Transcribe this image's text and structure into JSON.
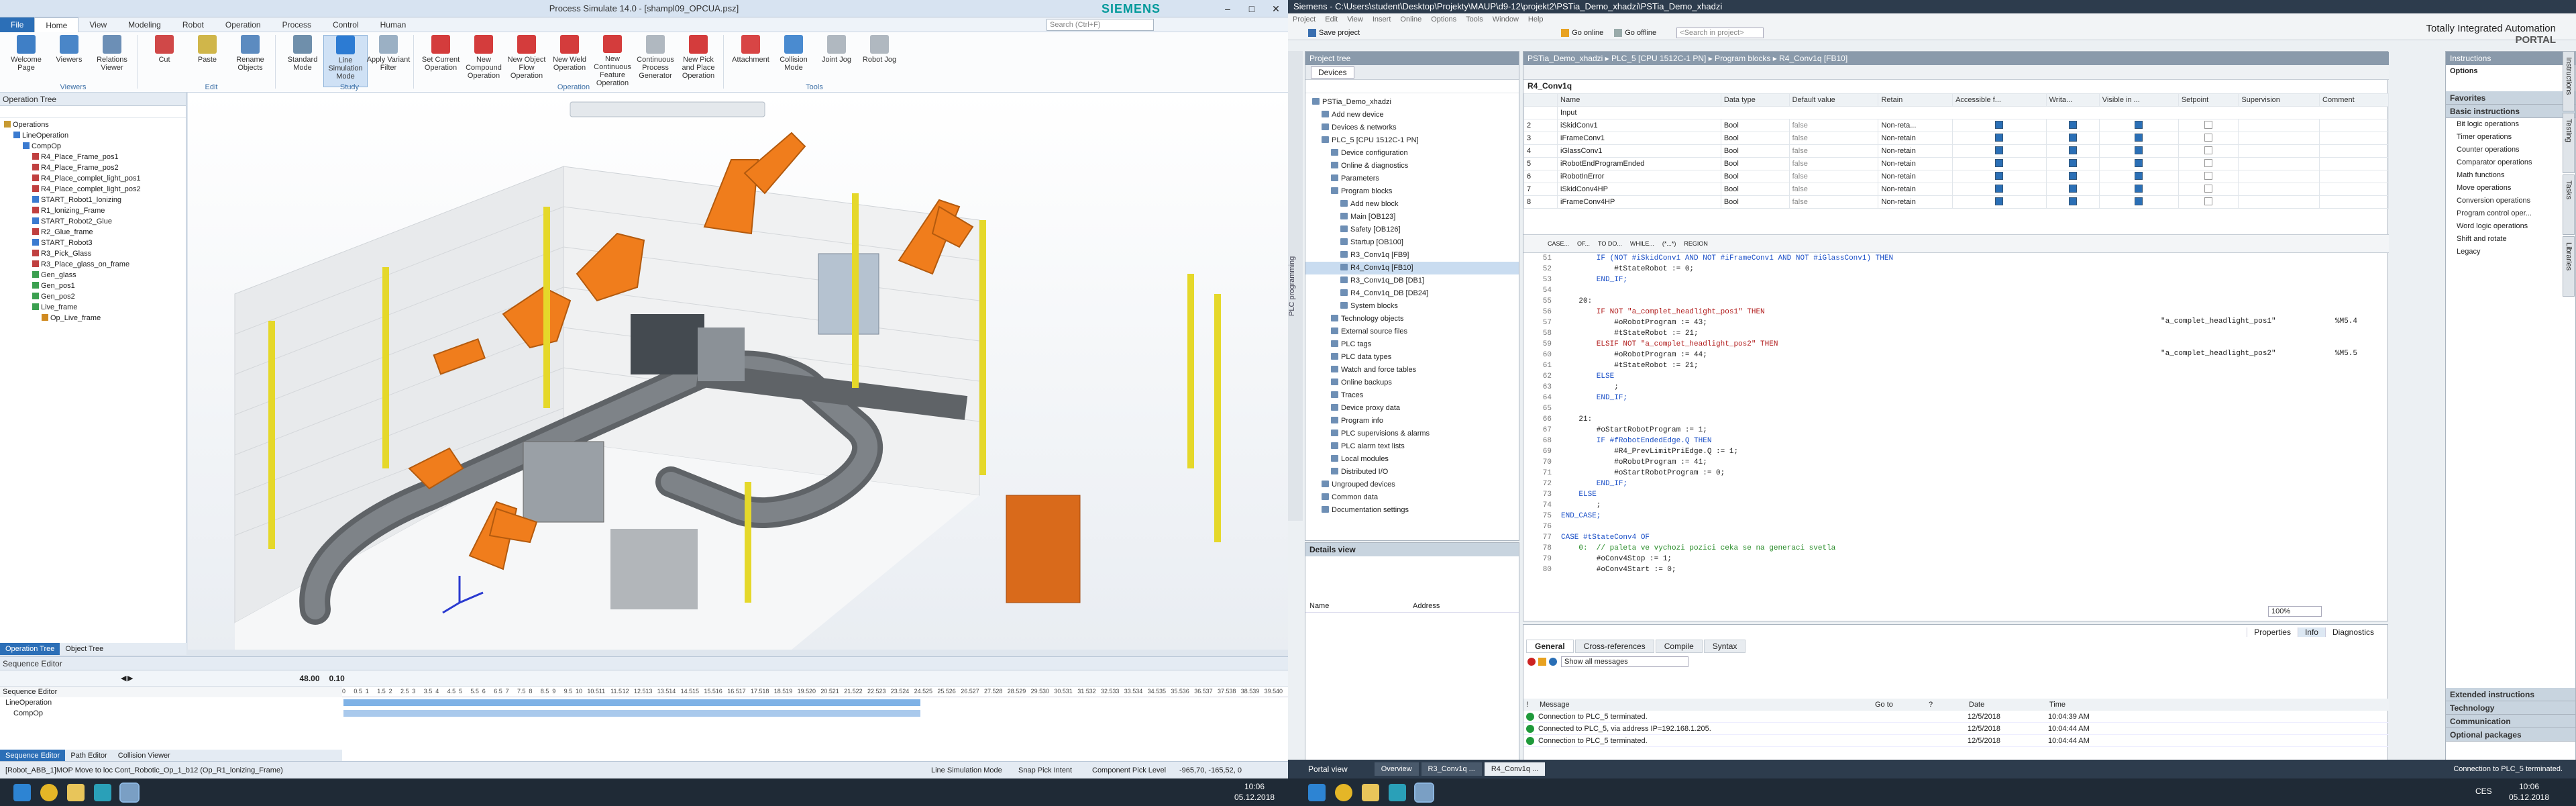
{
  "ps": {
    "title": "Process Simulate 14.0 - [shampl09_OPCUA.psz]",
    "brand": "SIEMENS",
    "menu": [
      "File",
      "Home",
      "View",
      "Modeling",
      "Robot",
      "Operation",
      "Process",
      "Control",
      "Human"
    ],
    "search_placeholder": "Search (Ctrl+F)",
    "ribbon": [
      {
        "label": "Welcome Page",
        "group": "Viewers"
      },
      {
        "label": "Viewers",
        "group": "Viewers"
      },
      {
        "label": "Relations Viewer",
        "group": "Viewers"
      },
      {
        "label": "Cut",
        "group": "Edit"
      },
      {
        "label": "Paste",
        "group": "Edit"
      },
      {
        "label": "Rename Objects",
        "group": "Edit"
      },
      {
        "label": "Standard Mode",
        "group": "Study"
      },
      {
        "label": "Line Simulation Mode",
        "group": "Study"
      },
      {
        "label": "Apply Variant Filter",
        "group": "Study"
      },
      {
        "label": "Set Current Operation",
        "group": "Operation"
      },
      {
        "label": "New Compound Operation",
        "group": "Operation"
      },
      {
        "label": "New Object Flow Operation",
        "group": "Operation"
      },
      {
        "label": "New Weld Operation",
        "group": "Operation"
      },
      {
        "label": "New Continuous Feature Operation",
        "group": "Operation"
      },
      {
        "label": "Continuous Process Generator",
        "group": "Operation"
      },
      {
        "label": "New Pick and Place Operation",
        "group": "Operation"
      },
      {
        "label": "Attachment",
        "group": "Tools"
      },
      {
        "label": "Collision Mode",
        "group": "Tools"
      },
      {
        "label": "Joint Jog",
        "group": "Tools"
      },
      {
        "label": "Robot Jog",
        "group": "Tools"
      }
    ],
    "ribbon_groups": [
      "Viewers",
      "Edit",
      "Study",
      "Operation",
      "Tools"
    ],
    "optree_title": "Operation Tree",
    "optree": [
      {
        "label": "Operations",
        "lvl": 0,
        "c": "#c79a32"
      },
      {
        "label": "LineOperation",
        "lvl": 1,
        "c": "#3b7bd0"
      },
      {
        "label": "CompOp",
        "lvl": 2,
        "c": "#3b7bd0"
      },
      {
        "label": "R4_Place_Frame_pos1",
        "lvl": 3,
        "c": "#c04040"
      },
      {
        "label": "R4_Place_Frame_pos2",
        "lvl": 3,
        "c": "#c04040"
      },
      {
        "label": "R4_Place_complet_light_pos1",
        "lvl": 3,
        "c": "#c04040"
      },
      {
        "label": "R4_Place_complet_light_pos2",
        "lvl": 3,
        "c": "#c04040"
      },
      {
        "label": "START_Robot1_lonizing",
        "lvl": 3,
        "c": "#3b7bd0"
      },
      {
        "label": "R1_lonizing_Frame",
        "lvl": 3,
        "c": "#c04040"
      },
      {
        "label": "START_Robot2_Glue",
        "lvl": 3,
        "c": "#3b7bd0"
      },
      {
        "label": "R2_Glue_frame",
        "lvl": 3,
        "c": "#c04040"
      },
      {
        "label": "START_Robot3",
        "lvl": 3,
        "c": "#3b7bd0"
      },
      {
        "label": "R3_Pick_Glass",
        "lvl": 3,
        "c": "#c04040"
      },
      {
        "label": "R3_Place_glass_on_frame",
        "lvl": 3,
        "c": "#c04040"
      },
      {
        "label": "Gen_glass",
        "lvl": 3,
        "c": "#3ba050"
      },
      {
        "label": "Gen_pos1",
        "lvl": 3,
        "c": "#3ba050"
      },
      {
        "label": "Gen_pos2",
        "lvl": 3,
        "c": "#3ba050"
      },
      {
        "label": "Live_frame",
        "lvl": 3,
        "c": "#3ba050"
      },
      {
        "label": "Op_Live_frame",
        "lvl": 4,
        "c": "#d08a20"
      }
    ],
    "tree_tabs": [
      "Operation Tree",
      "Object Tree"
    ],
    "seq_title": "Sequence Editor",
    "seq_time": "48.00",
    "seq_step": "0.10",
    "seq_rows": [
      "LineOperation",
      "CompOp"
    ],
    "seq_tabs": [
      "Sequence Editor",
      "Path Editor",
      "Collision Viewer"
    ],
    "ruler": [
      "0",
      "0.5",
      "1",
      "1.5",
      "2",
      "2.5",
      "3",
      "3.5",
      "4",
      "4.5",
      "5",
      "5.5",
      "6",
      "6.5",
      "7",
      "7.5",
      "8",
      "8.5",
      "9",
      "9.5",
      "10",
      "10.5",
      "11",
      "11.5",
      "12",
      "12.5",
      "13",
      "13.5",
      "14",
      "14.5",
      "15",
      "15.5",
      "16",
      "16.5",
      "17",
      "17.5",
      "18",
      "18.5",
      "19",
      "19.5",
      "20",
      "20.5",
      "21",
      "21.5",
      "22",
      "22.5",
      "23",
      "23.5",
      "24",
      "24.5",
      "25",
      "25.5",
      "26",
      "26.5",
      "27",
      "27.5",
      "28",
      "28.5",
      "29",
      "29.5",
      "30",
      "30.5",
      "31",
      "31.5",
      "32",
      "32.5",
      "33",
      "33.5",
      "34",
      "34.5",
      "35",
      "35.5",
      "36",
      "36.5",
      "37",
      "37.5",
      "38",
      "38.5",
      "39",
      "39.5",
      "40"
    ],
    "status_left": "[Robot_ABB_1]MOP Move to loc Cont_Robotic_Op_1_b12 (Op_R1_lonizing_Frame)",
    "status_mode": "Line Simulation Mode",
    "status_pick": "Snap Pick Intent",
    "status_level": "Component Pick Level",
    "status_coords": "-965,70, -165,52, 0"
  },
  "tia": {
    "title": "Siemens  -  C:\\Users\\student\\Desktop\\Projekty\\MAUP\\d9-12\\projekt2\\PSTia_Demo_xhadzi\\PSTia_Demo_xhadzi",
    "menu": [
      "Project",
      "Edit",
      "View",
      "Insert",
      "Online",
      "Options",
      "Tools",
      "Window",
      "Help"
    ],
    "toolbar": {
      "save": "Save project",
      "online": "Go online",
      "offline": "Go offline",
      "search": "<Search in project>"
    },
    "brand1": "Totally Integrated Automation",
    "brand2": "PORTAL",
    "project_tree_title": "Project tree",
    "devices_tab": "Devices",
    "tree": [
      {
        "label": "PSTia_Demo_xhadzi",
        "lvl": 0
      },
      {
        "label": "Add new device",
        "lvl": 1
      },
      {
        "label": "Devices & networks",
        "lvl": 1
      },
      {
        "label": "PLC_5 [CPU 1512C-1 PN]",
        "lvl": 1
      },
      {
        "label": "Device configuration",
        "lvl": 2
      },
      {
        "label": "Online & diagnostics",
        "lvl": 2
      },
      {
        "label": "Parameters",
        "lvl": 2
      },
      {
        "label": "Program blocks",
        "lvl": 2
      },
      {
        "label": "Add new block",
        "lvl": 3
      },
      {
        "label": "Main [OB123]",
        "lvl": 3
      },
      {
        "label": "Safety [OB126]",
        "lvl": 3
      },
      {
        "label": "Startup [OB100]",
        "lvl": 3
      },
      {
        "label": "R3_Conv1q [FB9]",
        "lvl": 3
      },
      {
        "label": "R4_Conv1q [FB10]",
        "lvl": 3,
        "sel": true
      },
      {
        "label": "R3_Conv1q_DB [DB1]",
        "lvl": 3
      },
      {
        "label": "R4_Conv1q_DB [DB24]",
        "lvl": 3
      },
      {
        "label": "System blocks",
        "lvl": 3
      },
      {
        "label": "Technology objects",
        "lvl": 2
      },
      {
        "label": "External source files",
        "lvl": 2
      },
      {
        "label": "PLC tags",
        "lvl": 2
      },
      {
        "label": "PLC data types",
        "lvl": 2
      },
      {
        "label": "Watch and force tables",
        "lvl": 2
      },
      {
        "label": "Online backups",
        "lvl": 2
      },
      {
        "label": "Traces",
        "lvl": 2
      },
      {
        "label": "Device proxy data",
        "lvl": 2
      },
      {
        "label": "Program info",
        "lvl": 2
      },
      {
        "label": "PLC supervisions & alarms",
        "lvl": 2
      },
      {
        "label": "PLC alarm text lists",
        "lvl": 2
      },
      {
        "label": "Local modules",
        "lvl": 2
      },
      {
        "label": "Distributed I/O",
        "lvl": 2
      },
      {
        "label": "Ungrouped devices",
        "lvl": 1
      },
      {
        "label": "Common data",
        "lvl": 1
      },
      {
        "label": "Documentation settings",
        "lvl": 1
      }
    ],
    "details_title": "Details view",
    "details_cols": [
      "Name",
      "Address"
    ],
    "breadcrumb": "PSTia_Demo_xhadzi  ▸  PLC_5 [CPU 1512C-1 PN]  ▸  Program blocks  ▸  R4_Conv1q [FB10]",
    "block_name": "R4_Conv1q",
    "iface_cols": [
      "Name",
      "Data type",
      "Default value",
      "Retain",
      "Accessible f...",
      "Writa...",
      "Visible in ...",
      "Setpoint",
      "Supervision",
      "Comment"
    ],
    "iface_section": "Input",
    "iface_rows": [
      {
        "no": "2",
        "name": "iSkidConv1",
        "type": "Bool",
        "def": "false",
        "ret": "Non-reta..."
      },
      {
        "no": "3",
        "name": "iFrameConv1",
        "type": "Bool",
        "def": "false",
        "ret": "Non-retain"
      },
      {
        "no": "4",
        "name": "iGlassConv1",
        "type": "Bool",
        "def": "false",
        "ret": "Non-retain"
      },
      {
        "no": "5",
        "name": "iRobotEndProgramEnded",
        "type": "Bool",
        "def": "false",
        "ret": "Non-retain"
      },
      {
        "no": "6",
        "name": "iRobotInError",
        "type": "Bool",
        "def": "false",
        "ret": "Non-retain"
      },
      {
        "no": "7",
        "name": "iSkidConv4HP",
        "type": "Bool",
        "def": "false",
        "ret": "Non-retain"
      },
      {
        "no": "8",
        "name": "iFrameConv4HP",
        "type": "Bool",
        "def": "false",
        "ret": "Non-retain"
      }
    ],
    "code_tabs": [
      "CASE...",
      "OF...",
      "TO DO...",
      "WHILE...",
      "(*...*)",
      "REGION"
    ],
    "code": [
      {
        "n": "51",
        "t": "        IF (NOT #iSkidConv1 AND NOT #iFrameConv1 AND NOT #iGlassConv1) THEN"
      },
      {
        "n": "52",
        "t": "            #tStateRobot := 0;"
      },
      {
        "n": "53",
        "t": "        END_IF;"
      },
      {
        "n": "54",
        "t": ""
      },
      {
        "n": "55",
        "t": "    20:"
      },
      {
        "n": "56",
        "t": "        IF NOT \"a_complet_headlight_pos1\" THEN"
      },
      {
        "n": "57",
        "t": "            #oRobotProgram := 43;"
      },
      {
        "n": "58",
        "t": "            #tStateRobot := 21;"
      },
      {
        "n": "59",
        "t": "        ELSIF NOT \"a_complet_headlight_pos2\" THEN"
      },
      {
        "n": "60",
        "t": "            #oRobotProgram := 44;"
      },
      {
        "n": "61",
        "t": "            #tStateRobot := 21;"
      },
      {
        "n": "62",
        "t": "        ELSE"
      },
      {
        "n": "63",
        "t": "            ;"
      },
      {
        "n": "64",
        "t": "        END_IF;"
      },
      {
        "n": "65",
        "t": ""
      },
      {
        "n": "66",
        "t": "    21:"
      },
      {
        "n": "67",
        "t": "        #oStartRobotProgram := 1;"
      },
      {
        "n": "68",
        "t": "        IF #fRobotEndedEdge.Q THEN"
      },
      {
        "n": "69",
        "t": "            #R4_PrevLimitPriEdge.Q := 1;"
      },
      {
        "n": "70",
        "t": "            #oRobotProgram := 41;"
      },
      {
        "n": "71",
        "t": "            #oStartRobotProgram := 0;"
      },
      {
        "n": "72",
        "t": "        END_IF;"
      },
      {
        "n": "73",
        "t": "    ELSE"
      },
      {
        "n": "74",
        "t": "        ;"
      },
      {
        "n": "75",
        "t": "END_CASE;"
      },
      {
        "n": "76",
        "t": ""
      },
      {
        "n": "77",
        "t": "CASE #tStateConv4 OF"
      },
      {
        "n": "78",
        "t": "    0:  // paleta ve vychozi pozici ceka se na generaci svetla"
      },
      {
        "n": "79",
        "t": "        #oConv4Stop := 1;"
      },
      {
        "n": "80",
        "t": "        #oConv4Start := 0;"
      }
    ],
    "watch": [
      {
        "row": 6,
        "name": "\"a_complet_headlight_pos1\"",
        "addr": "%M5.4"
      },
      {
        "row": 9,
        "name": "\"a_complet_headlight_pos2\"",
        "addr": "%M5.5"
      }
    ],
    "zoom": "100%",
    "insp_tabs": [
      "Properties",
      "Info",
      "Diagnostics"
    ],
    "insp_subtabs": [
      "General",
      "Cross-references",
      "Compile",
      "Syntax"
    ],
    "msg_filter": "Show all messages",
    "msg_cols": [
      "!",
      "Message",
      "Go to",
      "?",
      "Date",
      "Time"
    ],
    "messages": [
      {
        "msg": "Connection to PLC_5 terminated.",
        "date": "12/5/2018",
        "time": "10:04:39 AM"
      },
      {
        "msg": "Connected to PLC_5, via address IP=192.168.1.205.",
        "date": "12/5/2018",
        "time": "10:04:44 AM"
      },
      {
        "msg": "Connection to PLC_5 terminated.",
        "date": "12/5/2018",
        "time": "10:04:44 AM"
      }
    ],
    "instr_title": "Instructions",
    "options_title": "Options",
    "favorites": "Favorites",
    "basic": "Basic instructions",
    "basic_items": [
      "Bit logic operations",
      "Timer operations",
      "Counter operations",
      "Comparator operations",
      "Math functions",
      "Move operations",
      "Conversion operations",
      "Program control oper...",
      "Word logic operations",
      "Shift and rotate",
      "Legacy"
    ],
    "instr_groups": [
      "Extended instructions",
      "Technology",
      "Communication",
      "Optional packages"
    ],
    "side_tabs": [
      "Instructions",
      "Testing",
      "Tasks",
      "Libraries"
    ],
    "left_side": "PLC programming",
    "portal_view": "Portal view",
    "portal_tabs": [
      "Overview",
      "R3_Conv1q ...",
      "R4_Conv1q ..."
    ],
    "portal_status": "Connection to PLC_5 terminated."
  },
  "taskbar": {
    "time": "10:06",
    "date": "05.12.2018",
    "lang": "CES"
  }
}
